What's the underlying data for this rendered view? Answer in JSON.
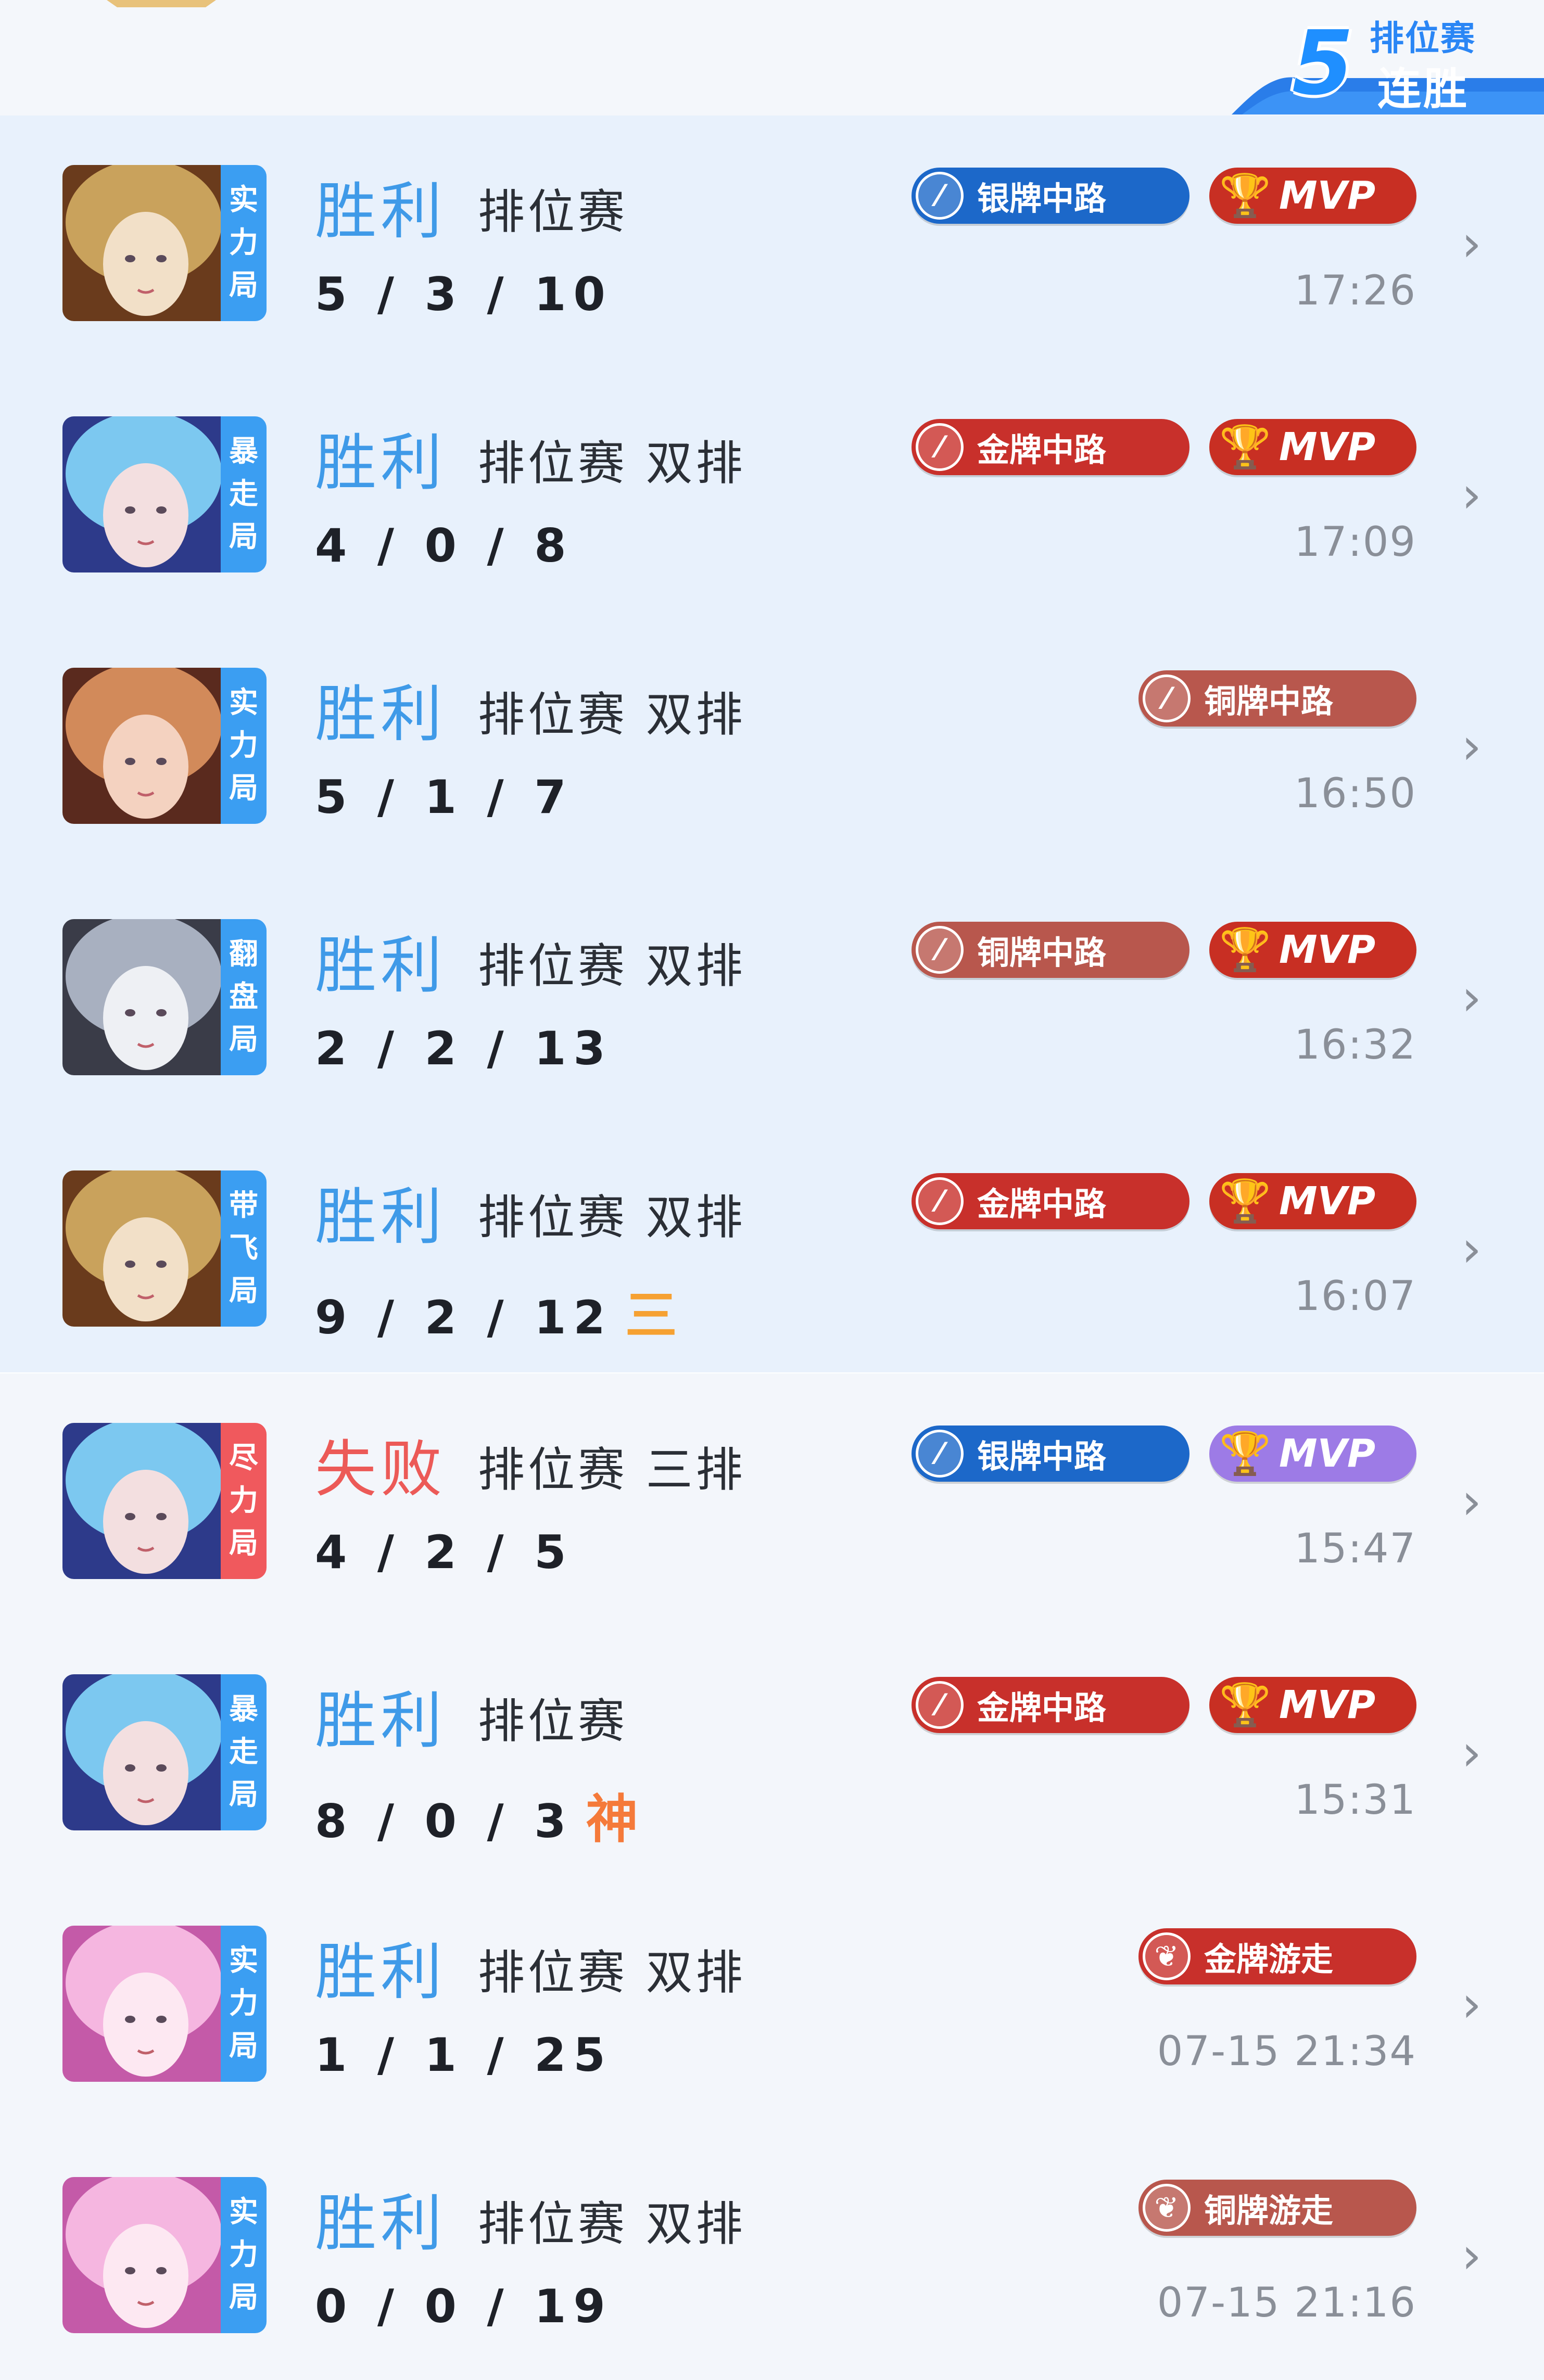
{
  "streak": {
    "number": "5",
    "line1": "排位赛",
    "line2": "连胜"
  },
  "matches": [
    {
      "result": "胜利",
      "mode": "排位赛",
      "kda": "5 / 3 / 10",
      "kda_badge": "",
      "tag": "实力局",
      "badge": "银牌中路",
      "mvp": "MVP",
      "time": "17:26"
    },
    {
      "result": "胜利",
      "mode": "排位赛 双排",
      "kda": "4 / 0 / 8",
      "kda_badge": "",
      "tag": "暴走局",
      "badge": "金牌中路",
      "mvp": "MVP",
      "time": "17:09"
    },
    {
      "result": "胜利",
      "mode": "排位赛 双排",
      "kda": "5 / 1 / 7",
      "kda_badge": "",
      "tag": "实力局",
      "badge": "铜牌中路",
      "mvp": "",
      "time": "16:50"
    },
    {
      "result": "胜利",
      "mode": "排位赛 双排",
      "kda": "2 / 2 / 13",
      "kda_badge": "",
      "tag": "翻盘局",
      "badge": "铜牌中路",
      "mvp": "MVP",
      "time": "16:32"
    },
    {
      "result": "胜利",
      "mode": "排位赛 双排",
      "kda": "9 / 2 / 12",
      "kda_badge": "三",
      "tag": "带飞局",
      "badge": "金牌中路",
      "mvp": "MVP",
      "time": "16:07"
    },
    {
      "result": "失败",
      "mode": "排位赛 三排",
      "kda": "4 / 2 / 5",
      "kda_badge": "",
      "tag": "尽力局",
      "badge": "银牌中路",
      "mvp": "MVP",
      "time": "15:47"
    },
    {
      "result": "胜利",
      "mode": "排位赛",
      "kda": "8 / 0 / 3",
      "kda_badge": "神",
      "tag": "暴走局",
      "badge": "金牌中路",
      "mvp": "MVP",
      "time": "15:31"
    },
    {
      "result": "胜利",
      "mode": "排位赛 双排",
      "kda": "1 / 1 / 25",
      "kda_badge": "",
      "tag": "实力局",
      "badge": "金牌游走",
      "mvp": "",
      "time": "07-15 21:34"
    },
    {
      "result": "胜利",
      "mode": "排位赛 双排",
      "kda": "0 / 0 / 19",
      "kda_badge": "",
      "tag": "实力局",
      "badge": "铜牌游走",
      "mvp": "",
      "time": "07-15 21:16"
    }
  ],
  "colors": {
    "win": "#3f9ae8",
    "lose": "#ec5a57",
    "silver": "#1c68c9",
    "gold": "#c8302b",
    "bronze": "#b8574d"
  },
  "icons": {
    "chevron": "chevron-right-icon",
    "lane": "mid-lane-icon",
    "support": "support-icon",
    "trophy": "trophy-icon"
  }
}
